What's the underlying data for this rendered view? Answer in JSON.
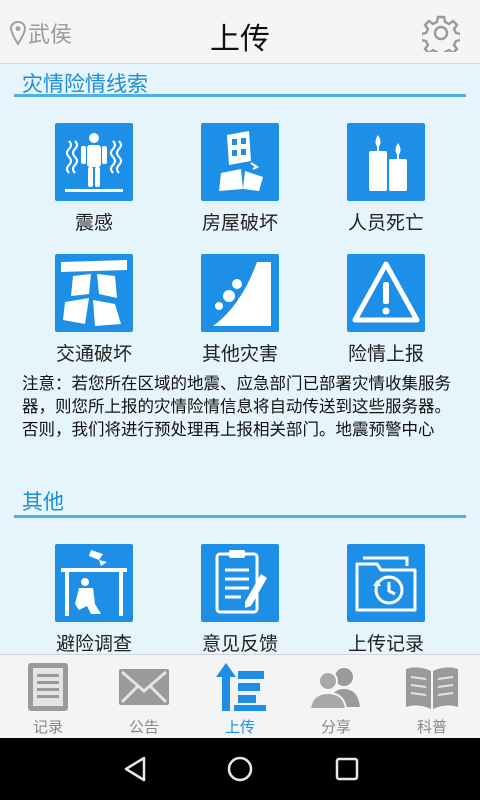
{
  "header": {
    "location": "武侯",
    "title": "上传",
    "icons": {
      "location": "location-pin-icon",
      "settings": "gear-icon"
    }
  },
  "sections": [
    {
      "title": "灾情险情线索",
      "items": [
        {
          "label": "震感",
          "icon": "shaking-person-icon"
        },
        {
          "label": "房屋破坏",
          "icon": "damaged-building-icon"
        },
        {
          "label": "人员死亡",
          "icon": "candles-icon"
        },
        {
          "label": "交通破坏",
          "icon": "broken-road-icon"
        },
        {
          "label": "其他灾害",
          "icon": "landslide-icon"
        },
        {
          "label": "险情上报",
          "icon": "warning-triangle-icon"
        }
      ]
    },
    {
      "title": "其他",
      "items": [
        {
          "label": "避险调查",
          "icon": "shelter-under-table-icon"
        },
        {
          "label": "意见反馈",
          "icon": "clipboard-pen-icon"
        },
        {
          "label": "上传记录",
          "icon": "folder-history-icon"
        }
      ]
    }
  ],
  "notice": "注意：若您所在区域的地震、应急部门已部署灾情收集服务器，则您所上报的灾情险情信息将自动传送到这些服务器。否则，我们将进行预处理再上报相关部门。地震预警中心",
  "tabs": [
    {
      "label": "记录",
      "icon": "list-document-icon"
    },
    {
      "label": "公告",
      "icon": "envelope-icon"
    },
    {
      "label": "上传",
      "icon": "upload-arrow-icon",
      "active": true
    },
    {
      "label": "分享",
      "icon": "people-icon"
    },
    {
      "label": "科普",
      "icon": "open-book-icon"
    }
  ],
  "colors": {
    "accent": "#1e8fe6",
    "background": "#e6f5fb",
    "inactive": "#888888"
  }
}
